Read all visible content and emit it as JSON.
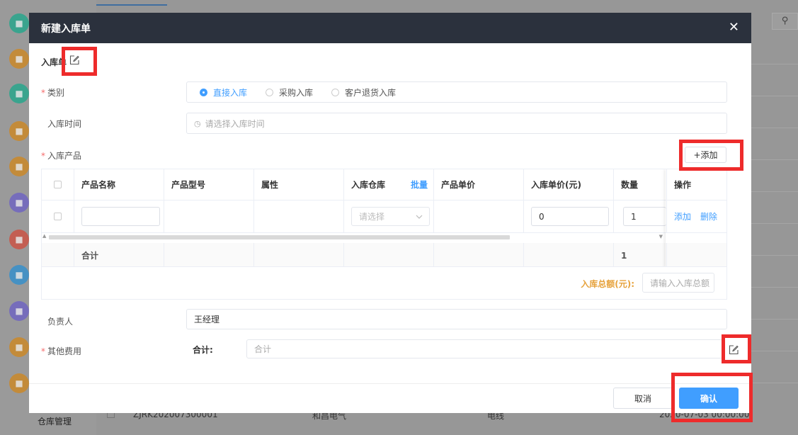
{
  "background": {
    "sidebar_label": "仓库管理",
    "bottom_row": {
      "code": "ZJRK202007300001",
      "company": "和昌电气",
      "product": "电线",
      "time": "2020-07-03 00:00:00"
    },
    "sidebar_icon_colors": [
      "#1aa88a",
      "#d1861b",
      "#1aa88a",
      "#d1861b",
      "#d1861b",
      "#6b5fc7",
      "#d14a3a",
      "#2a8fd1",
      "#6b5fc7",
      "#d1861b",
      "#d1861b",
      "#d14a3a"
    ]
  },
  "modal": {
    "title": "新建入库单",
    "fields": {
      "order_no_label": "入库单",
      "category_label": "类别",
      "category_options": [
        "直接入库",
        "采购入库",
        "客户退货入库"
      ],
      "category_selected": "直接入库",
      "time_label": "入库时间",
      "time_placeholder": "请选择入库时间",
      "products_label": "入库产品",
      "add_button": "+添加",
      "manager_label": "负责人",
      "manager_value": "王经理",
      "other_fees_label": "其他费用",
      "total_label": "合计:",
      "total_placeholder": "合计"
    },
    "table": {
      "headers": [
        "产品名称",
        "产品型号",
        "属性",
        "入库仓库",
        "产品单价",
        "入库单价(元)",
        "数量",
        "操作"
      ],
      "batch_link": "批量",
      "row": {
        "warehouse_placeholder": "请选择",
        "unit_price": "0",
        "quantity": "1",
        "add_link": "添加",
        "delete_link": "删除"
      },
      "footer": {
        "sum_label": "合计",
        "sum_quantity": "1"
      }
    },
    "total_amount_label": "入库总额(元):",
    "total_amount_placeholder": "请输入入库总额",
    "cancel_button": "取消",
    "confirm_button": "确认"
  },
  "colors": {
    "primary": "#409eff",
    "header_bg": "#2b313d",
    "required": "#f56c6c",
    "highlight": "#ee2b2b",
    "total_label": "#e6a23c"
  }
}
